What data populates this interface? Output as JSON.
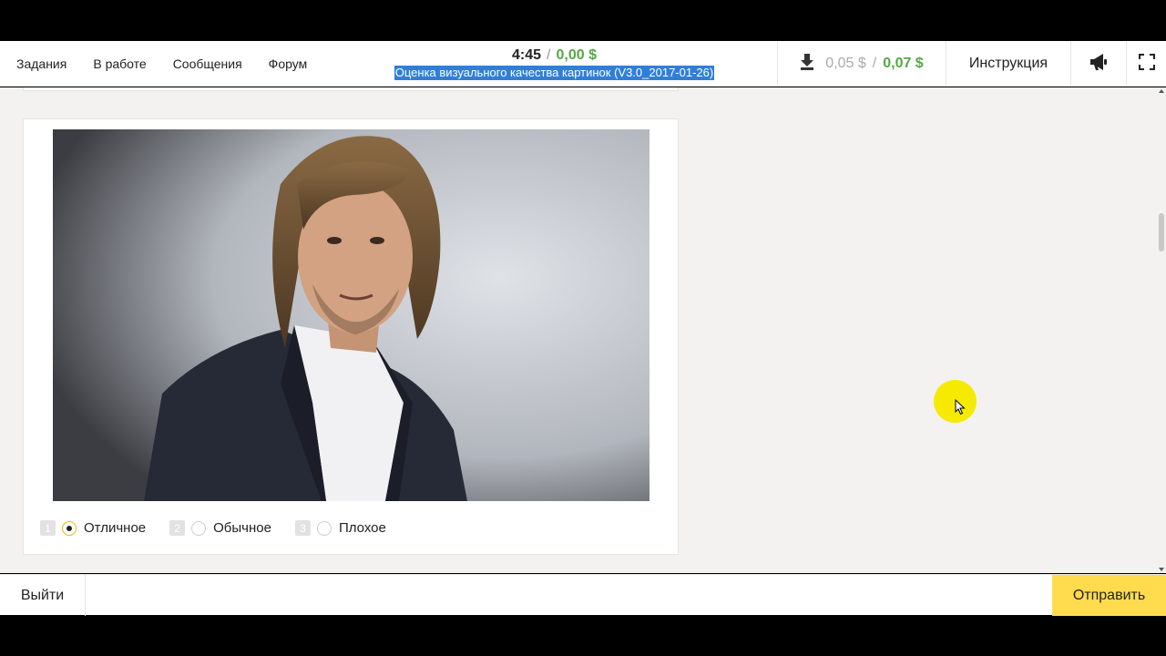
{
  "nav": {
    "items": [
      {
        "label": "Задания"
      },
      {
        "label": "В работе"
      },
      {
        "label": "Сообщения"
      },
      {
        "label": "Форум"
      }
    ]
  },
  "task_info": {
    "timer": "4:45",
    "separator": "/",
    "earned": "0,00 $",
    "project_title": "Оценка визуального качества картинок (V3.0_2017-01-26)"
  },
  "balance": {
    "icon": "download-icon",
    "pending": "0,05 $",
    "separator": "/",
    "available": "0,07 $"
  },
  "toolbar": {
    "instructions_label": "Инструкция",
    "announce_icon": "megaphone-icon",
    "fullscreen_icon": "fullscreen-icon"
  },
  "task": {
    "image_alt": "portrait-photo",
    "options": [
      {
        "hotkey": "1",
        "label": "Отличное",
        "selected": true
      },
      {
        "hotkey": "2",
        "label": "Обычное",
        "selected": false
      },
      {
        "hotkey": "3",
        "label": "Плохое",
        "selected": false
      }
    ]
  },
  "footer": {
    "exit_label": "Выйти",
    "submit_label": "Отправить"
  },
  "colors": {
    "accent_yellow": "#ffdb4d",
    "earn_green": "#53a944",
    "selection_blue": "#2f7fd9",
    "background": "#f3f2f0"
  }
}
